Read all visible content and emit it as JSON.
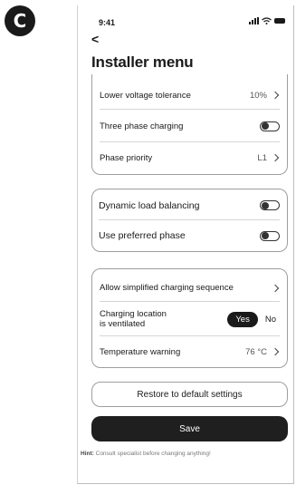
{
  "panel_label": "C",
  "status_bar": {
    "time": "9:41"
  },
  "header": {
    "back_symbol": "<",
    "title": "Installer menu"
  },
  "card1": {
    "rows": [
      {
        "label": "Lower voltage tolerance",
        "value": "10%"
      },
      {
        "label": "Three phase charging"
      },
      {
        "label": "Phase priority",
        "value": "L1"
      }
    ]
  },
  "card2": {
    "rows": [
      {
        "label": "Dynamic load balancing"
      },
      {
        "label": "Use preferred phase"
      }
    ]
  },
  "card3": {
    "row1": {
      "label": "Allow simplified charging sequence"
    },
    "row2": {
      "label_line1": "Charging location",
      "label_line2": "is ventilated",
      "yes": "Yes",
      "no": "No"
    },
    "row3": {
      "label": "Temperature warning",
      "value": "76 °C"
    }
  },
  "actions": {
    "restore": "Restore to default settings",
    "save": "Save"
  },
  "hint": {
    "prefix": "Hint:",
    "text": "Consult specialist before changing anything!"
  },
  "colors": {
    "primary": "#1f1f1f",
    "border": "#9e9e9e"
  }
}
